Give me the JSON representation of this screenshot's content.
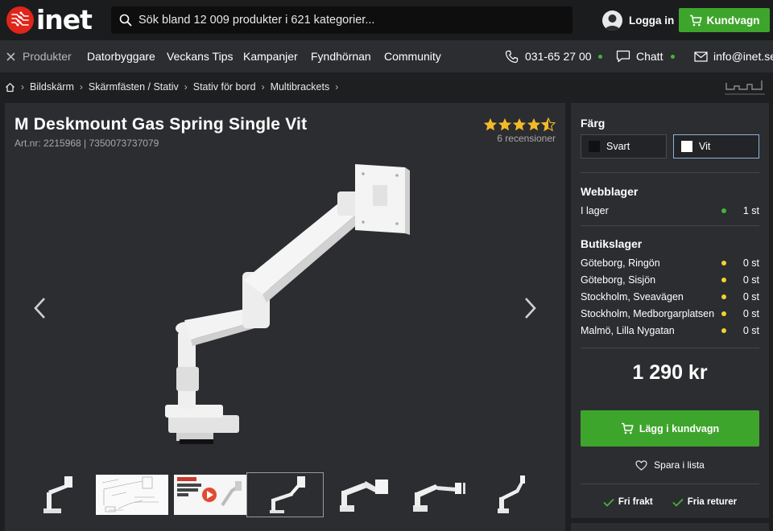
{
  "header": {
    "logo_text": "inet",
    "search_placeholder": "Sök bland 12 009 produkter i 621 kategorier...",
    "login_label": "Logga in",
    "cart_label": "Kundvagn"
  },
  "nav": {
    "products_label": "Produkter",
    "items": [
      "Datorbyggare",
      "Veckans Tips",
      "Kampanjer",
      "Fyndhörnan",
      "Community"
    ],
    "phone": "031-65 27 00",
    "chat": "Chatt",
    "email": "info@inet.se"
  },
  "breadcrumb": [
    "Bildskärm",
    "Skärmfästen / Stativ",
    "Stativ för bord",
    "Multibrackets"
  ],
  "product": {
    "title": "M Deskmount Gas Spring Single Vit",
    "art_nr": "Art.nr: 2215968 | 7350073737079",
    "rating": 4.5,
    "reviews": "6 recensioner"
  },
  "side": {
    "color_heading": "Färg",
    "colors": [
      {
        "label": "Svart",
        "swatch": "#111111",
        "selected": false
      },
      {
        "label": "Vit",
        "swatch": "#ffffff",
        "selected": true
      }
    ],
    "web_stock_heading": "Webblager",
    "web_stock": [
      {
        "name": "I lager",
        "qty": "1 st",
        "status_color": "#47b23d"
      }
    ],
    "store_stock_heading": "Butikslager",
    "store_stock": [
      {
        "name": "Göteborg, Ringön",
        "qty": "0 st",
        "status_color": "#f2d22e"
      },
      {
        "name": "Göteborg, Sisjön",
        "qty": "0 st",
        "status_color": "#f2d22e"
      },
      {
        "name": "Stockholm, Sveavägen",
        "qty": "0 st",
        "status_color": "#f2d22e"
      },
      {
        "name": "Stockholm, Medborgarplatsen",
        "qty": "0 st",
        "status_color": "#f2d22e"
      },
      {
        "name": "Malmö, Lilla Nygatan",
        "qty": "0 st",
        "status_color": "#f2d22e"
      }
    ],
    "price": "1 290 kr",
    "add_to_cart": "Lägg i kundvagn",
    "save_list": "Spara i lista",
    "perks": [
      "Fri frakt",
      "Fria returer"
    ]
  },
  "thumb_video_text": "M Deskmount Gas Spring Single",
  "colors": {
    "accent_green": "#3ea52c",
    "brand_red": "#e0251b",
    "in_stock": "#47b23d",
    "store_status": "#f2d22e"
  }
}
